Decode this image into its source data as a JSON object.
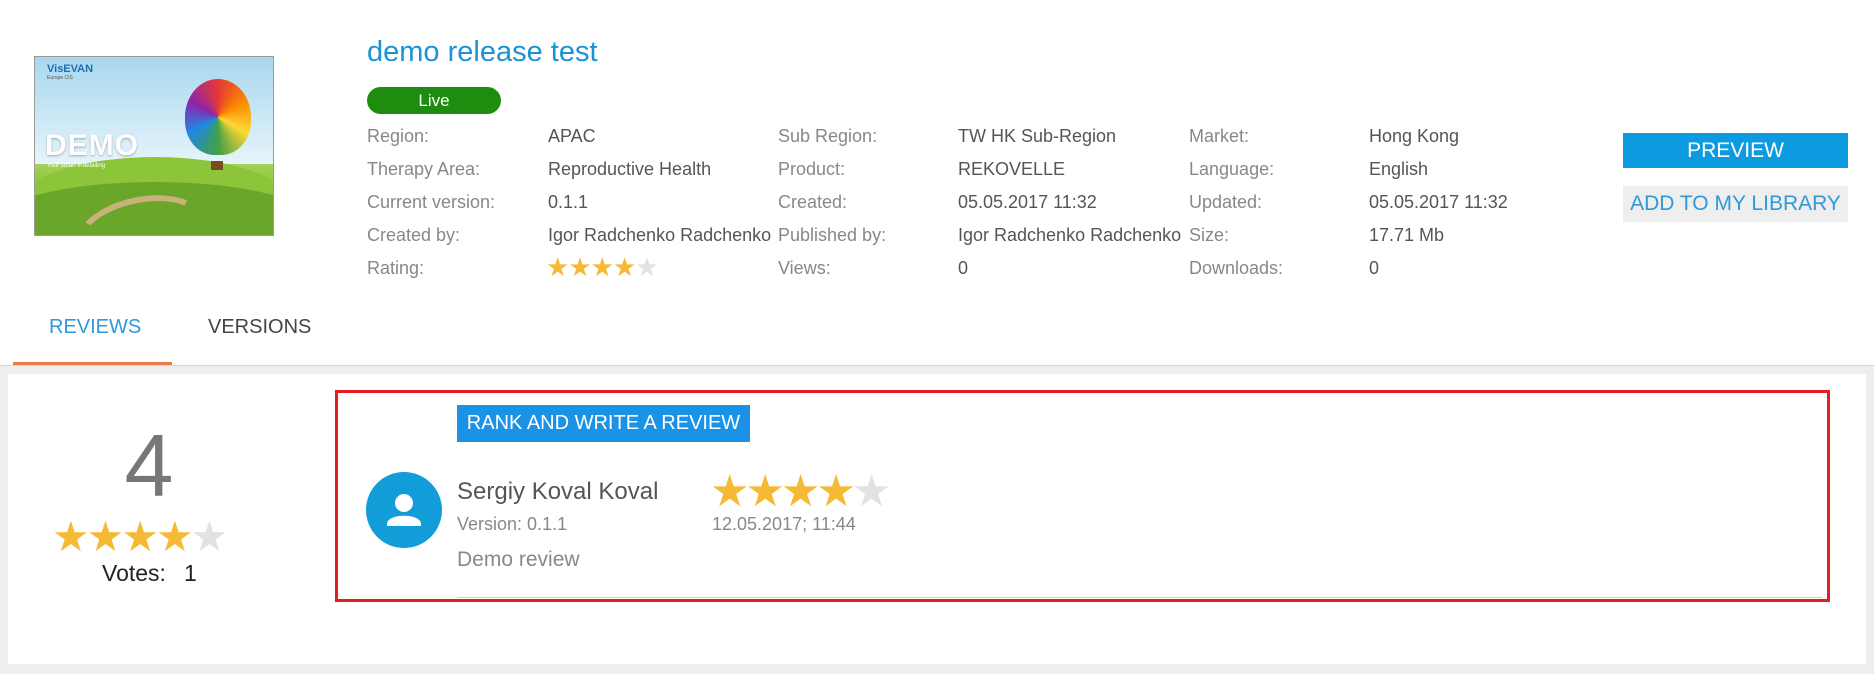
{
  "header": {
    "title": "demo release test",
    "status_badge": "Live",
    "thumbnail": {
      "logo": "VisEVAN",
      "logo_sub": "Europe CIS",
      "heading": "DEMO",
      "tagline": "Your smart e-detailing"
    }
  },
  "details": {
    "col1": [
      {
        "label": "Region:",
        "value": "APAC"
      },
      {
        "label": "Therapy Area:",
        "value": "Reproductive Health"
      },
      {
        "label": "Current version:",
        "value": "0.1.1"
      },
      {
        "label": "Created by:",
        "value": "Igor Radchenko Radchenko"
      },
      {
        "label": "Rating:",
        "value": ""
      }
    ],
    "col2": [
      {
        "label": "Sub Region:",
        "value": "TW HK Sub-Region"
      },
      {
        "label": "Product:",
        "value": "REKOVELLE"
      },
      {
        "label": "Created:",
        "value": "05.05.2017 11:32"
      },
      {
        "label": "Published by:",
        "value": "Igor Radchenko Radchenko"
      },
      {
        "label": "Views:",
        "value": "0"
      }
    ],
    "col3": [
      {
        "label": "Market:",
        "value": "Hong Kong"
      },
      {
        "label": "Language:",
        "value": "English"
      },
      {
        "label": "Updated:",
        "value": "05.05.2017 11:32"
      },
      {
        "label": "Size:",
        "value": "17.71 Mb"
      },
      {
        "label": "Downloads:",
        "value": "0"
      }
    ],
    "rating_stars": 4,
    "rating_max": 5
  },
  "actions": {
    "preview": "PREVIEW",
    "add_to_library": "ADD TO MY LIBRARY"
  },
  "tabs": [
    {
      "label": "REVIEWS",
      "active": true
    },
    {
      "label": "VERSIONS",
      "active": false
    }
  ],
  "reviews": {
    "average": "4",
    "average_stars": 4,
    "votes_label": "Votes:",
    "votes_count": "1",
    "rank_button": "RANK AND WRITE A REVIEW",
    "items": [
      {
        "author": "Sergiy Koval Koval",
        "version": "Version: 0.1.1",
        "stars": 4,
        "date": "12.05.2017; 11:44",
        "text": "Demo review"
      }
    ]
  },
  "colors": {
    "accent": "#1a93d6",
    "live": "#1e8c0e",
    "star": "#f5b934",
    "highlight": "#e41e25",
    "tab_underline": "#e87b47"
  }
}
